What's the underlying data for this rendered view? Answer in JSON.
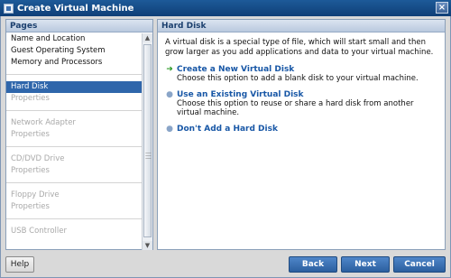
{
  "window": {
    "title": "Create Virtual Machine",
    "close_glyph": "×"
  },
  "pages_panel": {
    "header": "Pages",
    "items": [
      {
        "label": "Name and Location",
        "state": "normal"
      },
      {
        "label": "Guest Operating System",
        "state": "normal"
      },
      {
        "label": "Memory and Processors",
        "state": "normal"
      },
      {
        "label": "Hard Disk",
        "state": "selected"
      },
      {
        "label": "Properties",
        "state": "disabled"
      },
      {
        "label": "Network Adapter",
        "state": "disabled"
      },
      {
        "label": "Properties",
        "state": "disabled"
      },
      {
        "label": "CD/DVD Drive",
        "state": "disabled"
      },
      {
        "label": "Properties",
        "state": "disabled"
      },
      {
        "label": "Floppy Drive",
        "state": "disabled"
      },
      {
        "label": "Properties",
        "state": "disabled"
      },
      {
        "label": "USB Controller",
        "state": "disabled"
      }
    ]
  },
  "content": {
    "header": "Hard Disk",
    "intro": "A virtual disk is a special type of file, which will start small and then grow larger as you add applications and data to your virtual machine.",
    "options": [
      {
        "title": "Create a New Virtual Disk",
        "description": "Choose this option to add a blank disk to your virtual machine.",
        "marker": "arrow"
      },
      {
        "title": "Use an Existing Virtual Disk",
        "description": "Choose this option to reuse or share a hard disk from another virtual machine.",
        "marker": "bullet"
      },
      {
        "title": "Don't Add a Hard Disk",
        "description": "",
        "marker": "bullet"
      }
    ]
  },
  "buttons": {
    "help": "Help",
    "back": "Back",
    "next": "Next",
    "cancel": "Cancel"
  },
  "colors": {
    "titlebar": "#1d5a99",
    "selected": "#2f66ab",
    "link": "#1857a6",
    "accent_arrow": "#2d9a27"
  }
}
